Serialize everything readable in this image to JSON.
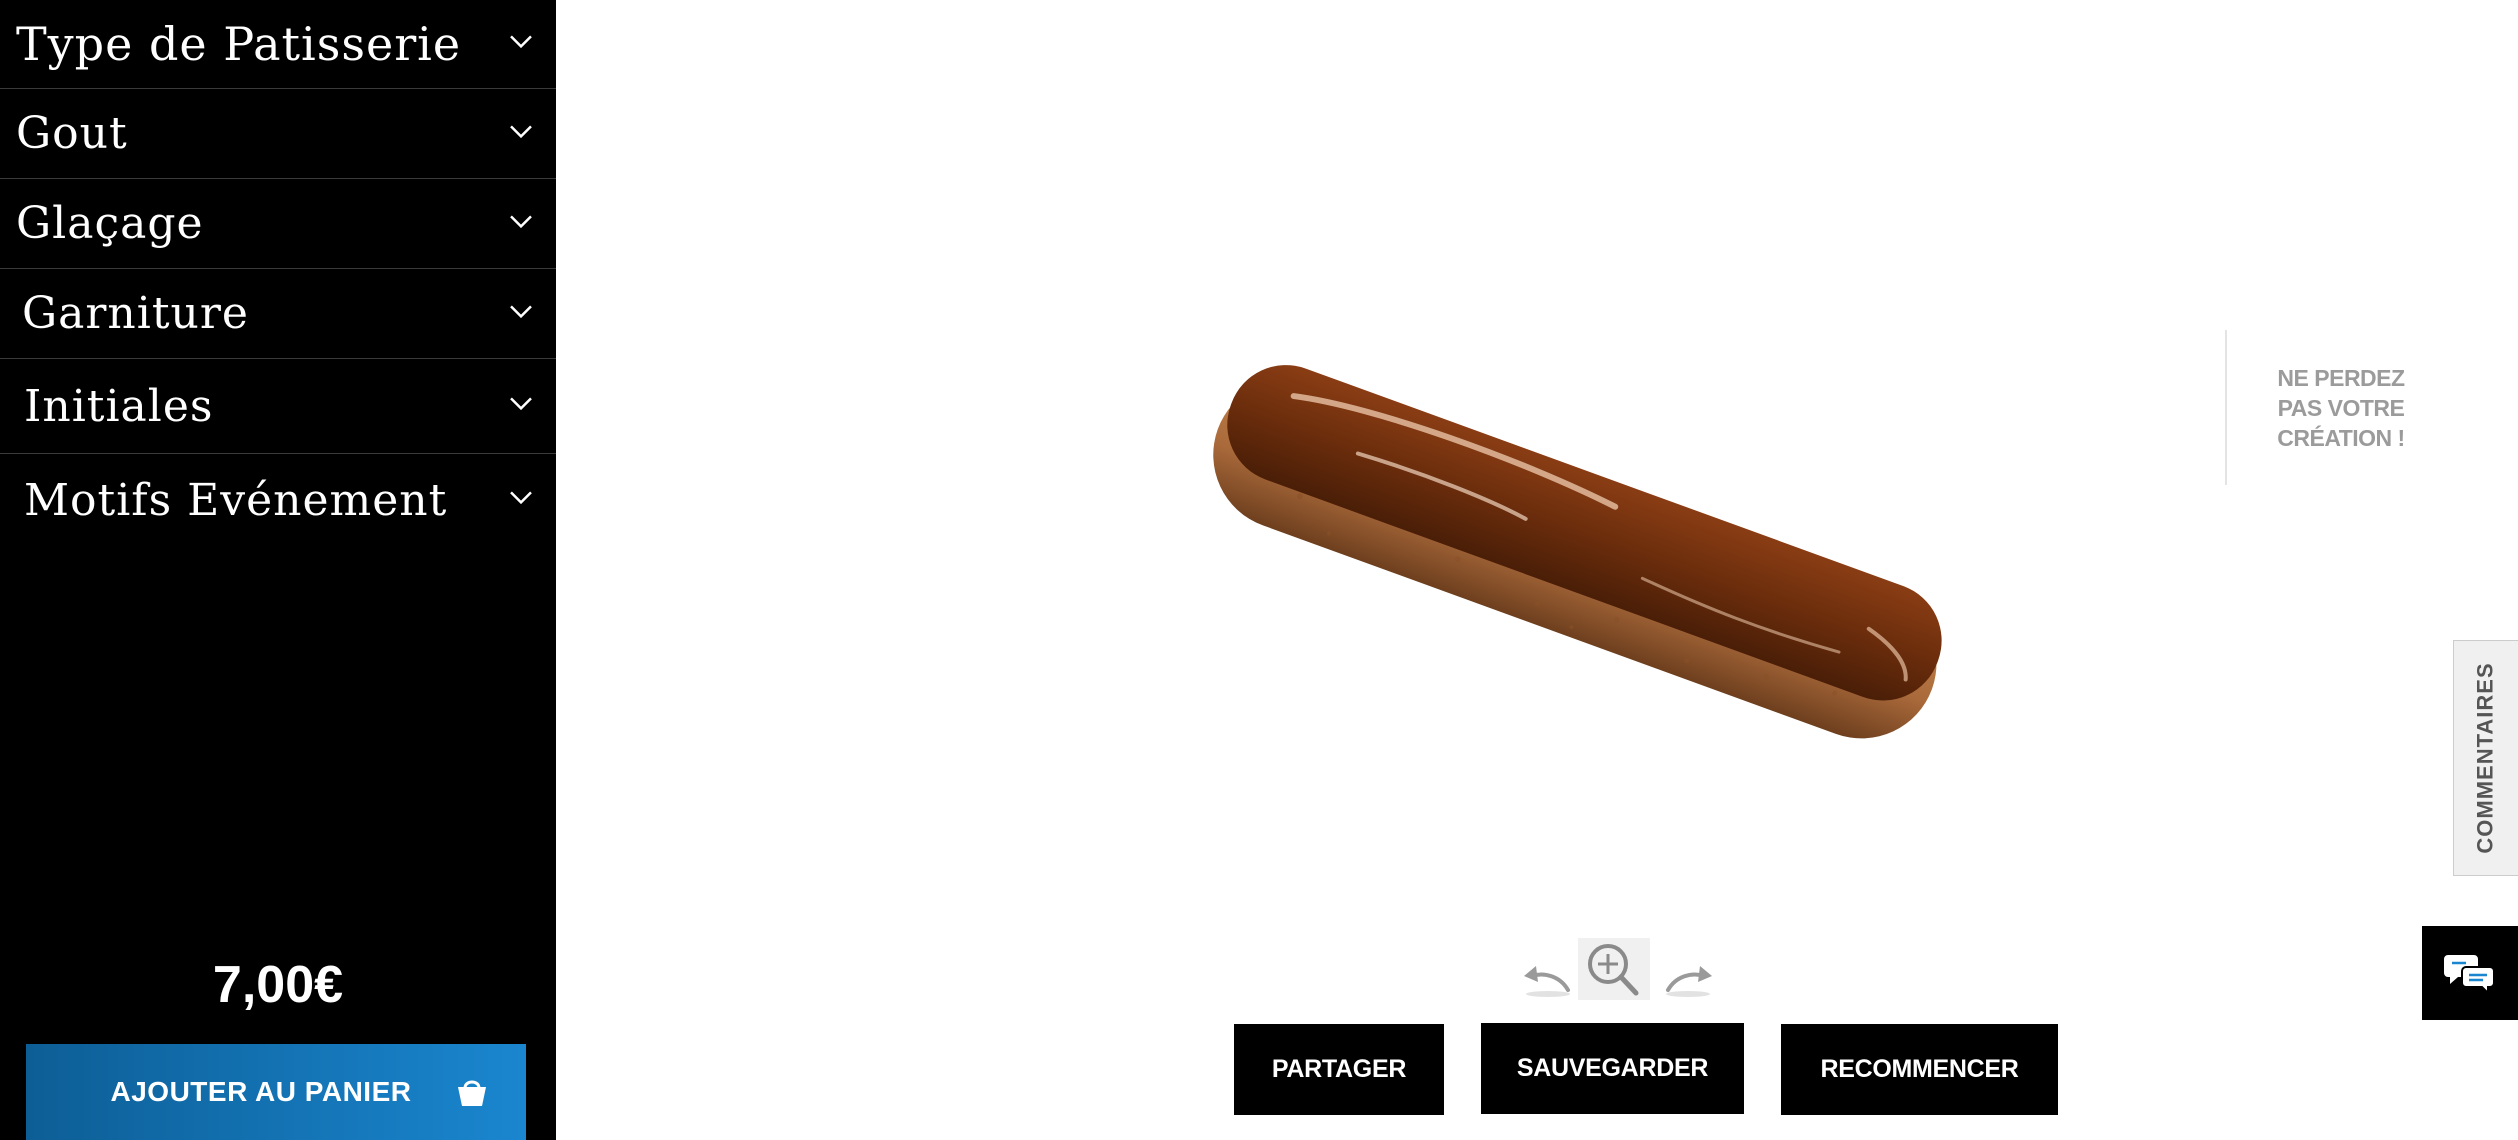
{
  "sidebar": {
    "menu": [
      {
        "label": "Type de Patisserie"
      },
      {
        "label": "Gout"
      },
      {
        "label": "Glaçage"
      },
      {
        "label": "Garniture"
      },
      {
        "label": "Initiales"
      },
      {
        "label": "Motifs Evénement"
      }
    ],
    "price": "7,00€",
    "cart_button": "AJOUTER AU PANIER"
  },
  "main": {
    "save_note": "NE PERDEZ PAS VOTRE CRÉATION !",
    "comments_tab": "COMMENTAIRES",
    "actions": {
      "share": "PARTAGER",
      "save": "SAUVEGARDER",
      "restart": "RECOMMENCER"
    }
  },
  "icons": {
    "menu_chevron": "chevron-down-icon",
    "cart": "basket-icon",
    "rotate_left": "rotate-left-icon",
    "zoom": "zoom-in-icon",
    "rotate_right": "rotate-right-icon",
    "chat": "chat-bubbles-icon"
  },
  "colors": {
    "sidebar_bg": "#000000",
    "cart_gradient_start": "#0d5e96",
    "cart_gradient_end": "#1a86cf",
    "note_text": "#9b9b9b",
    "glaze": "#6b2d0c",
    "pastry": "#b9763d"
  }
}
